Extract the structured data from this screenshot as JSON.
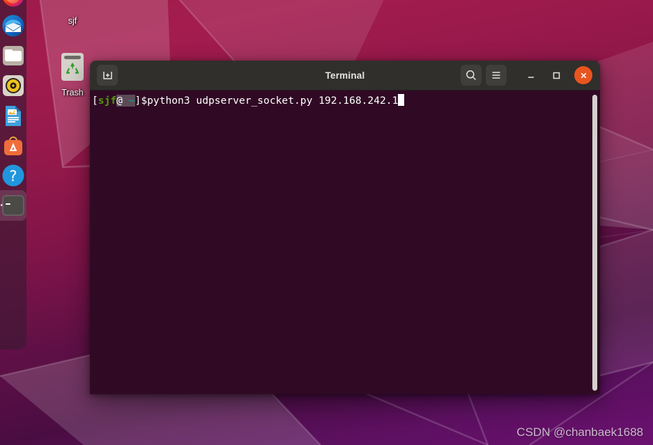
{
  "desktop": {
    "wallpaper_top_color": "#9e1b4a",
    "wallpaper_bottom_color": "#6b1170",
    "icons": [
      {
        "name": "sjf",
        "label": "sjf",
        "type": "folder-icon"
      },
      {
        "name": "trash",
        "label": "Trash",
        "type": "trash-icon"
      }
    ],
    "watermark": "CSDN @chanbaek1688"
  },
  "dock": {
    "background": "#3c1934",
    "items": [
      {
        "name": "firefox",
        "label": "Firefox",
        "running": false
      },
      {
        "name": "thunderbird",
        "label": "Thunderbird",
        "running": false
      },
      {
        "name": "files",
        "label": "Files",
        "running": false
      },
      {
        "name": "rhythmbox",
        "label": "Rhythmbox",
        "running": false
      },
      {
        "name": "libreoffice-writer",
        "label": "LibreOffice Writer",
        "running": false
      },
      {
        "name": "ubuntu-software",
        "label": "Ubuntu Software",
        "running": false
      },
      {
        "name": "help",
        "label": "Help",
        "running": false
      },
      {
        "name": "terminal",
        "label": "Terminal",
        "running": true
      }
    ]
  },
  "terminal": {
    "title": "Terminal",
    "background": "#300a24",
    "buttons": {
      "new_tab": "New Tab",
      "search": "Search",
      "menu": "Menu",
      "minimize": "Minimize",
      "maximize": "Maximize",
      "close": "Close"
    },
    "close_button_color": "#e9541f",
    "prompt": {
      "bracket_open": "[",
      "user": "sjf",
      "at": "@",
      "path": "~",
      "bracket_close": "]$"
    },
    "command": "python3 udpserver_socket.py 192.168.242.1",
    "cursor_visible": true,
    "scrollbar_visible": true
  }
}
